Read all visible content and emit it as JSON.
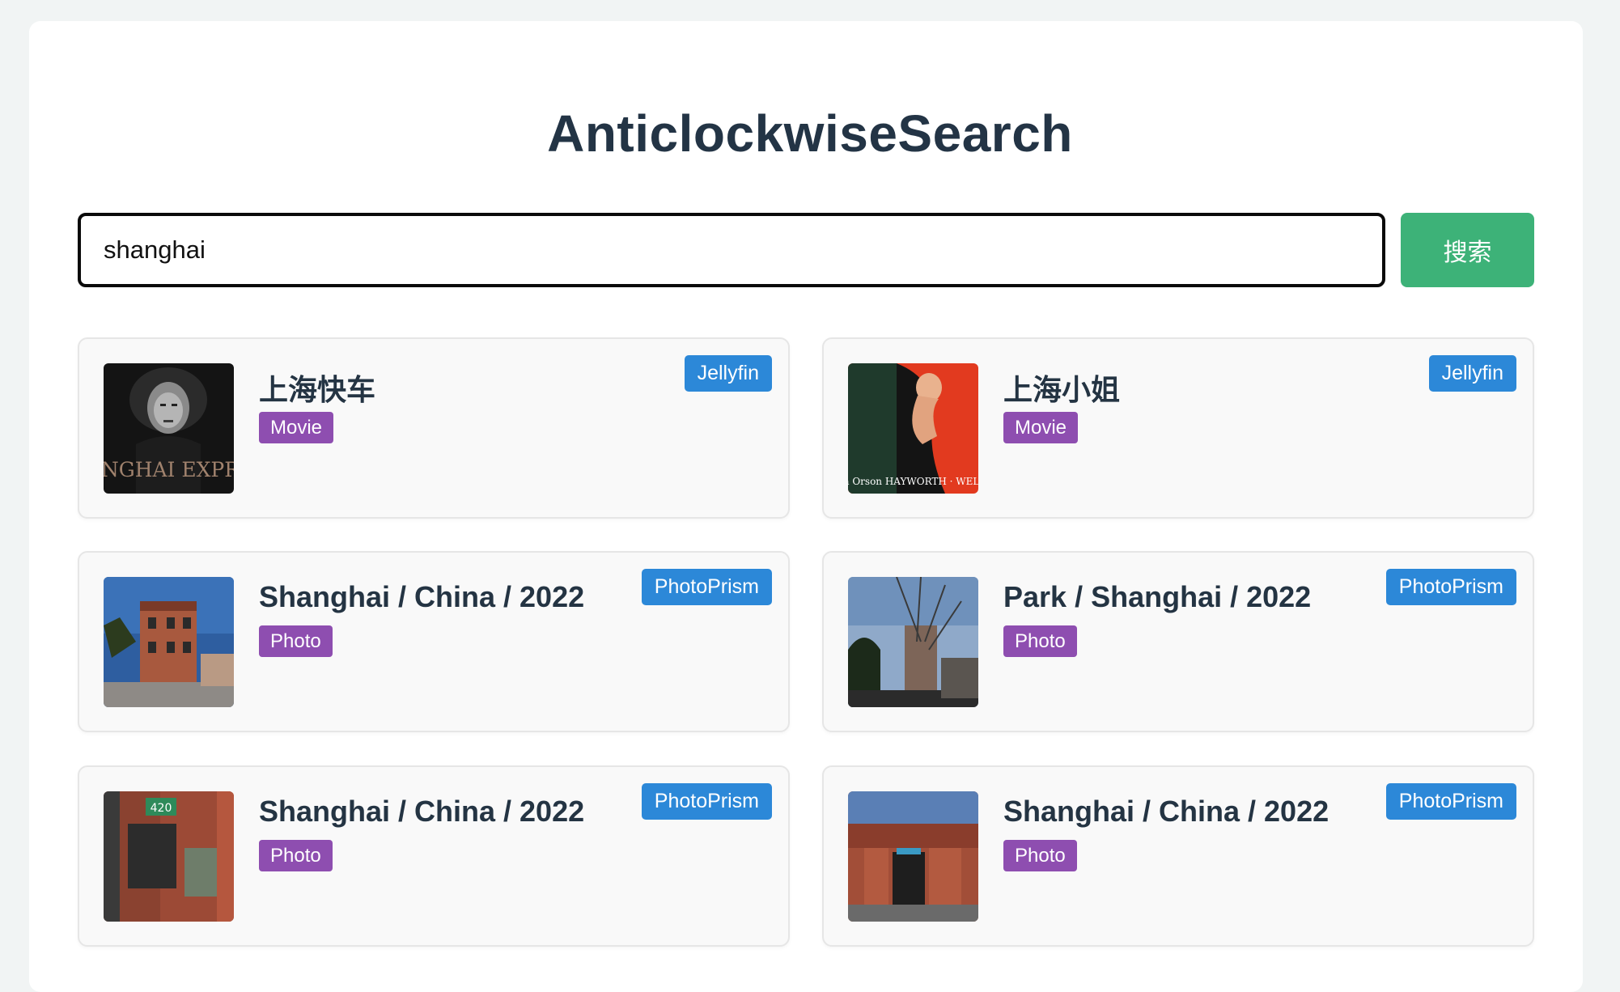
{
  "app": {
    "title": "AnticlockwiseSearch"
  },
  "search": {
    "value": "shanghai",
    "button_label": "搜索"
  },
  "colors": {
    "title": "#233445",
    "search_button": "#3db278",
    "source_badge": "#2c88d8",
    "type_badge": "#8e4eb0"
  },
  "results": [
    {
      "title": "上海快车",
      "type": "Movie",
      "source": "Jellyfin",
      "thumb_text": "SHANGHAI EXPRESS",
      "thumb_icon": "movie-poster-icon"
    },
    {
      "title": "上海小姐",
      "type": "Movie",
      "source": "Jellyfin",
      "thumb_text": "Rita Orson HAYWORTH · WELLES",
      "thumb_icon": "movie-poster-icon"
    },
    {
      "title": "Shanghai / China / 2022",
      "type": "Photo",
      "source": "PhotoPrism",
      "thumb_icon": "photo-icon"
    },
    {
      "title": "Park / Shanghai / 2022",
      "type": "Photo",
      "source": "PhotoPrism",
      "thumb_icon": "photo-icon"
    },
    {
      "title": "Shanghai / China / 2022",
      "type": "Photo",
      "source": "PhotoPrism",
      "thumb_text": "420",
      "thumb_icon": "photo-icon"
    },
    {
      "title": "Shanghai / China / 2022",
      "type": "Photo",
      "source": "PhotoPrism",
      "thumb_icon": "photo-icon"
    }
  ]
}
